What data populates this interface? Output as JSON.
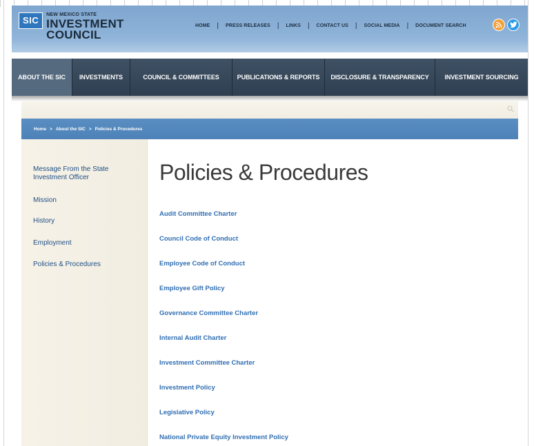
{
  "logo": {
    "badge": "SIC",
    "line1": "NEW MEXICO STATE",
    "line2": "INVESTMENT",
    "line3": "COUNCIL"
  },
  "topnav": [
    "HOME",
    "PRESS RELEASES",
    "LINKS",
    "CONTACT US",
    "SOCIAL MEDIA",
    "DOCUMENT SEARCH"
  ],
  "social": {
    "rss_icon": "rss-icon",
    "twitter_icon": "twitter-icon",
    "rss_color": "#f3a23a",
    "twitter_color": "#2e9be6"
  },
  "mainnav": [
    {
      "label": "ABOUT THE SIC",
      "active": true
    },
    {
      "label": "INVESTMENTS",
      "active": false
    },
    {
      "label": "COUNCIL & COMMITTEES",
      "active": false
    },
    {
      "label": "PUBLICATIONS & REPORTS",
      "active": false
    },
    {
      "label": "DISCLOSURE & TRANSPARENCY",
      "active": false
    },
    {
      "label": "INVESTMENT SOURCING",
      "active": false
    }
  ],
  "breadcrumb": [
    "Home",
    "About the SIC",
    "Policies & Procedures"
  ],
  "breadcrumb_sep": ">",
  "sidebar": [
    "Message From the State Investment Officer",
    "Mission",
    "History",
    "Employment",
    "Policies & Procedures"
  ],
  "page_title": "Policies & Procedures",
  "documents": [
    "Audit Committee Charter",
    "Council Code of Conduct",
    "Employee Code of Conduct",
    "Employee Gift Policy",
    "Governance Committee Charter",
    "Internal Audit Charter",
    "Investment Committee Charter",
    "Investment Policy",
    "Legislative Policy",
    "National Private Equity Investment Policy"
  ],
  "colors": {
    "link": "#2f6eb2",
    "nav_bg": "#2f3f51",
    "breadcrumb_bg": "#5a8ec2",
    "header_bg": "#8db2d8"
  }
}
